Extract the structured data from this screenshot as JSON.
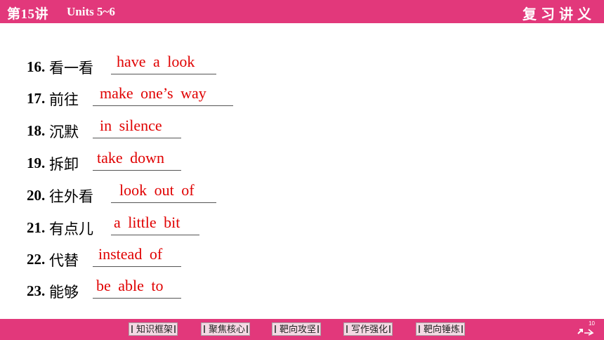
{
  "header": {
    "lesson": "第15讲",
    "units": "Units 5~6",
    "section": "复习讲义"
  },
  "items": [
    {
      "num": "16.",
      "zh": "看一看",
      "answer": "have  a  look"
    },
    {
      "num": "17.",
      "zh": "前往",
      "answer": "make  one’s  way"
    },
    {
      "num": "18.",
      "zh": "沉默",
      "answer": "in  silence"
    },
    {
      "num": "19.",
      "zh": "拆卸",
      "answer": "take  down"
    },
    {
      "num": "20.",
      "zh": "往外看",
      "answer": "look  out  of"
    },
    {
      "num": "21.",
      "zh": "有点儿",
      "answer": "a  little  bit"
    },
    {
      "num": "22.",
      "zh": "代替",
      "answer": "instead  of"
    },
    {
      "num": "23.",
      "zh": "能够",
      "answer": "be  able  to"
    }
  ],
  "footer": {
    "nav": [
      "知识框架",
      "聚焦核心",
      "靶向攻坚",
      "写作强化",
      "靶向锤炼"
    ],
    "page": "10"
  },
  "colors": {
    "accent": "#e2387b",
    "answer": "#e00000"
  }
}
